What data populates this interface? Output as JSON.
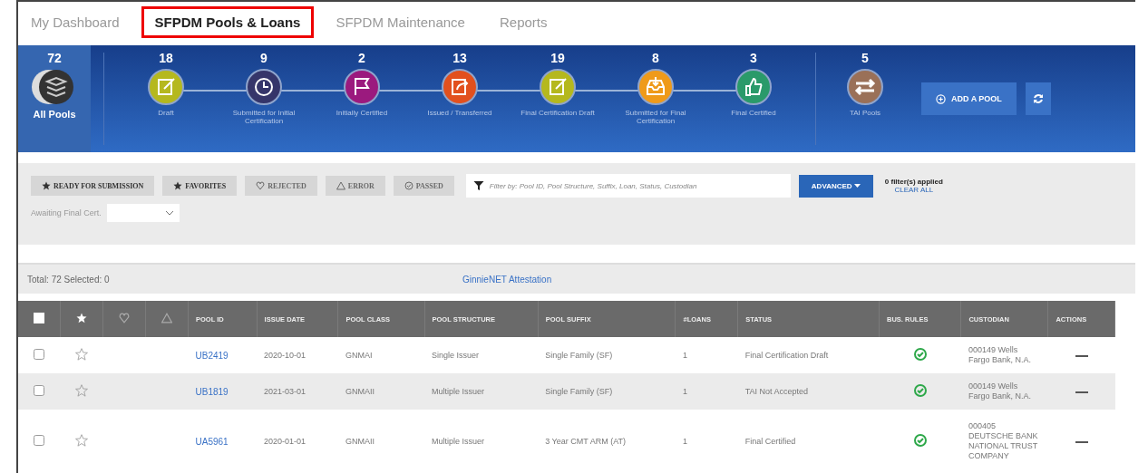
{
  "tabs": [
    {
      "label": "My Dashboard",
      "selected": false
    },
    {
      "label": "SFPDM Pools & Loans",
      "selected": true
    },
    {
      "label": "SFPDM Maintenance",
      "selected": false
    },
    {
      "label": "Reports",
      "selected": false
    }
  ],
  "summary": {
    "all_pools": {
      "count": "72",
      "label": "All Pools",
      "selected": true
    },
    "stages": [
      {
        "count": "18",
        "label": "Draft",
        "kind": "draft",
        "color": "#b5b81e"
      },
      {
        "count": "9",
        "label": "Submitted for Initial Certification",
        "kind": "clock",
        "color": "#35356a"
      },
      {
        "count": "2",
        "label": "Initially Certified",
        "kind": "flag",
        "color": "#9b1a7e"
      },
      {
        "count": "13",
        "label": "Issued / Transferred",
        "kind": "transfer",
        "color": "#e2501e"
      },
      {
        "count": "19",
        "label": "Final Certification Draft",
        "kind": "draft",
        "color": "#b5b81e"
      },
      {
        "count": "8",
        "label": "Submitted for Final Certification",
        "kind": "inbox",
        "color": "#ef9a1a"
      },
      {
        "count": "3",
        "label": "Final Certified",
        "kind": "thumb",
        "color": "#2a9a6a"
      }
    ],
    "tai": {
      "count": "5",
      "label": "TAI Pools",
      "kind": "arrows",
      "color": "#9a7058"
    },
    "add_button": "ADD A POOL"
  },
  "filters": {
    "quick": [
      {
        "label": "READY FOR SUBMISSION",
        "kind": "star",
        "disabled": false
      },
      {
        "label": "FAVORITES",
        "kind": "star",
        "disabled": false
      },
      {
        "label": "REJECTED",
        "kind": "heart",
        "disabled": true
      },
      {
        "label": "ERROR",
        "kind": "warning",
        "disabled": true
      },
      {
        "label": "PASSED",
        "kind": "check",
        "disabled": true
      }
    ],
    "search_placeholder": "Filter by: Pool ID, Pool Structure, Suffix, Loan, Status, Custodian",
    "advanced": "ADVANCED",
    "applied": "0 filter(s) applied",
    "clear": "CLEAR ALL",
    "awaiting_label": "Awaiting Final Cert."
  },
  "totals": {
    "text": "Total: 72 Selected: 0",
    "link": "GinnieNET Attestation"
  },
  "table": {
    "columns": [
      {
        "kind": "checkbox",
        "checked": false
      },
      {
        "kind": "star"
      },
      {
        "kind": "heart"
      },
      {
        "kind": "warning"
      },
      {
        "kind": "text",
        "label": "POOL ID"
      },
      {
        "kind": "text",
        "label": "ISSUE DATE"
      },
      {
        "kind": "text",
        "label": "POOL CLASS"
      },
      {
        "kind": "text",
        "label": "POOL STRUCTURE"
      },
      {
        "kind": "text",
        "label": "POOL SUFFIX"
      },
      {
        "kind": "text",
        "label": "#LOANS"
      },
      {
        "kind": "text",
        "label": "STATUS"
      },
      {
        "kind": "text",
        "label": "BUS. RULES"
      },
      {
        "kind": "text",
        "label": "CUSTODIAN"
      },
      {
        "kind": "text",
        "label": "ACTIONS"
      }
    ],
    "rows": [
      {
        "checked": false,
        "favorite": false,
        "pool_id": "UB2419",
        "issue_date": "2020-10-01",
        "pool_class": "GNMAI",
        "structure": "Single Issuer",
        "suffix": "Single Family (SF)",
        "loans": "1",
        "status": "Final Certification Draft",
        "rules_passed": true,
        "custodian": "000149 Wells Fargo Bank, N.A."
      },
      {
        "checked": false,
        "favorite": false,
        "pool_id": "UB1819",
        "issue_date": "2021-03-01",
        "pool_class": "GNMAII",
        "structure": "Multiple Issuer",
        "suffix": "Single Family (SF)",
        "loans": "1",
        "status": "TAI Not Accepted",
        "rules_passed": true,
        "custodian": "000149 Wells Fargo Bank, N.A."
      },
      {
        "checked": false,
        "favorite": false,
        "pool_id": "UA5961",
        "issue_date": "2020-01-01",
        "pool_class": "GNMAII",
        "structure": "Multiple Issuer",
        "suffix": "3 Year CMT ARM (AT)",
        "loans": "1",
        "status": "Final Certified",
        "rules_passed": true,
        "custodian": "000405 DEUTSCHE BANK NATIONAL TRUST COMPANY"
      }
    ]
  }
}
